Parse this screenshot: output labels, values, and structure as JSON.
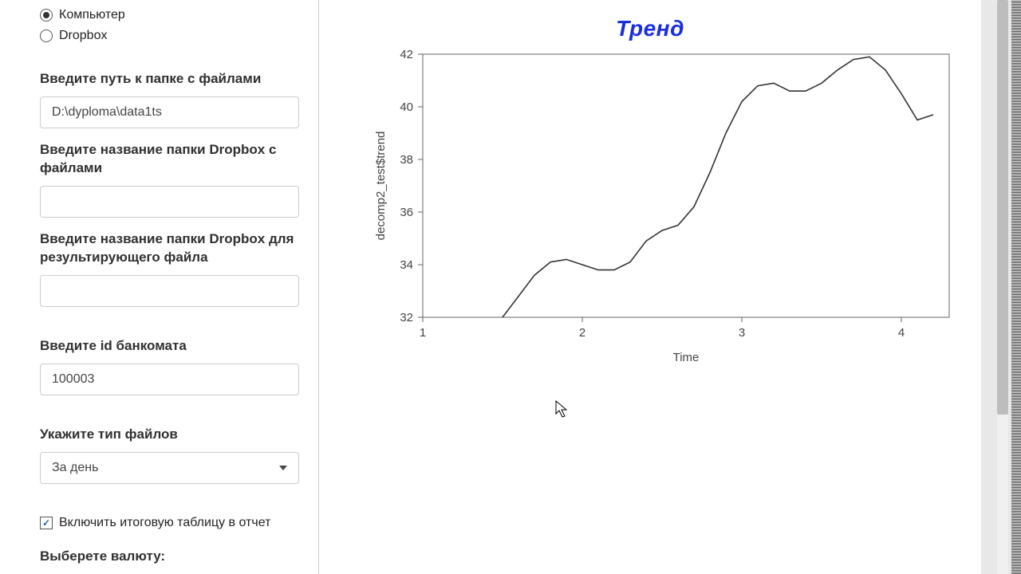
{
  "sidebar": {
    "source_radios": {
      "computer": "Компьютер",
      "dropbox": "Dropbox",
      "selected": "computer"
    },
    "path_label": "Введите путь к папке с файлами",
    "path_value": "D:\\dyploma\\data1ts",
    "dropbox_input_label": "Введите название папки Dropbox с файлами",
    "dropbox_input_value": "",
    "dropbox_output_label": "Введите название папки Dropbox для результирующего файла",
    "dropbox_output_value": "",
    "atm_id_label": "Введите id банкомата",
    "atm_id_value": "100003",
    "file_type_label": "Укажите тип файлов",
    "file_type_value": "За день",
    "include_checkbox_label": "Включить итоговую таблицу в отчет",
    "include_checkbox_checked": true,
    "currency_label": "Выберете валюту:"
  },
  "chart_data": {
    "type": "line",
    "title": "Тренд",
    "xlabel": "Time",
    "ylabel": "decomp2_test$trend",
    "xlim": [
      1,
      4.3
    ],
    "ylim": [
      32,
      42
    ],
    "x_ticks": [
      1,
      2,
      3,
      4
    ],
    "y_ticks": [
      32,
      34,
      36,
      38,
      40,
      42
    ],
    "series": [
      {
        "name": "trend",
        "x": [
          1.5,
          1.6,
          1.7,
          1.8,
          1.9,
          2.0,
          2.1,
          2.2,
          2.3,
          2.4,
          2.5,
          2.6,
          2.7,
          2.8,
          2.9,
          3.0,
          3.1,
          3.2,
          3.3,
          3.4,
          3.5,
          3.6,
          3.7,
          3.8,
          3.9,
          4.0,
          4.1,
          4.2
        ],
        "y": [
          32.0,
          32.8,
          33.6,
          34.1,
          34.2,
          34.0,
          33.8,
          33.8,
          34.1,
          34.9,
          35.3,
          35.5,
          36.2,
          37.5,
          39.0,
          40.2,
          40.8,
          40.9,
          40.6,
          40.6,
          40.9,
          41.4,
          41.8,
          41.9,
          41.4,
          40.5,
          39.5,
          39.7
        ]
      }
    ]
  }
}
